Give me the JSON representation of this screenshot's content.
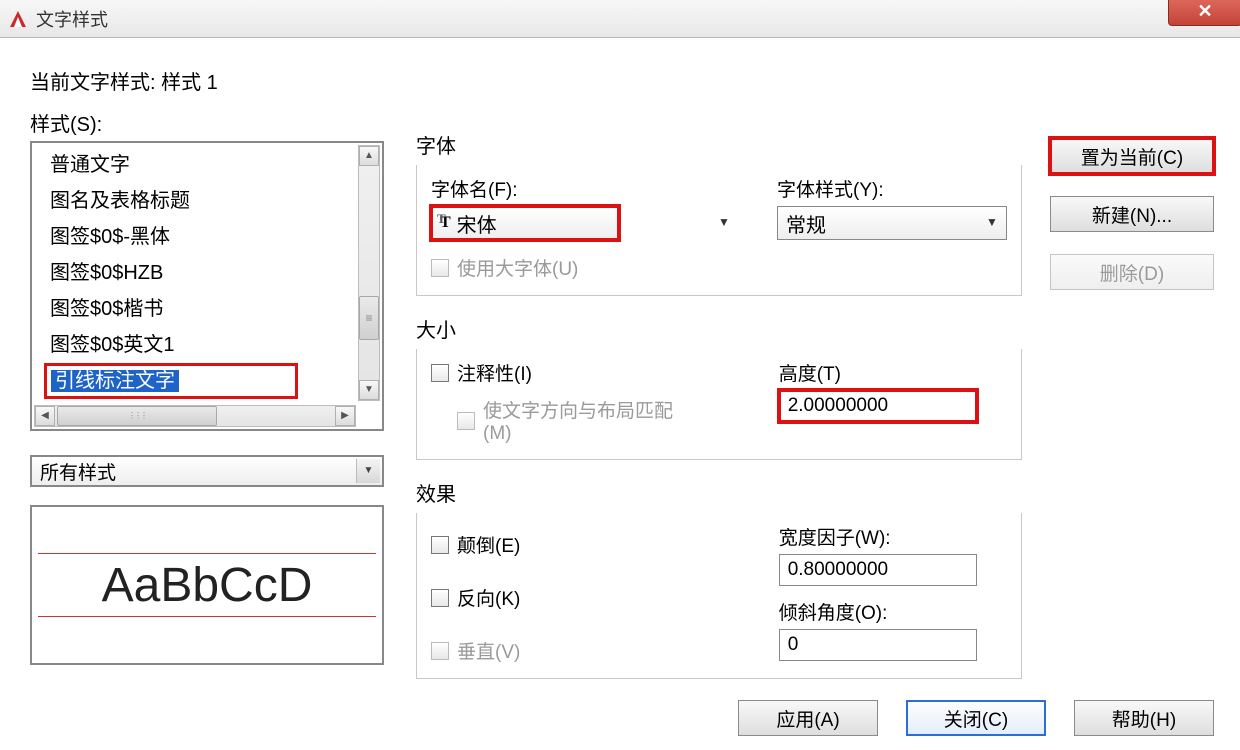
{
  "window": {
    "title": "文字样式"
  },
  "current_style_label": "当前文字样式:  样式 1",
  "styles_label": "样式(S):",
  "styles_list": {
    "items": [
      "普通文字",
      "图名及表格标题",
      "图签$0$-黑体",
      "图签$0$HZB",
      "图签$0$楷书",
      "图签$0$英文1"
    ],
    "selected": "引线标注文字"
  },
  "filter": {
    "value": "所有样式"
  },
  "preview": {
    "text": "AaBbCcD"
  },
  "font": {
    "group_label": "字体",
    "name_label": "字体名(F):",
    "name_value": "宋体",
    "style_label": "字体样式(Y):",
    "style_value": "常规",
    "bigfont_label": "使用大字体(U)"
  },
  "size": {
    "group_label": "大小",
    "annot_label": "注释性(I)",
    "match_label": "使文字方向与布局匹配(M)",
    "height_label": "高度(T)",
    "height_value": "2.00000000"
  },
  "effects": {
    "group_label": "效果",
    "upside_label": "颠倒(E)",
    "backwards_label": "反向(K)",
    "vertical_label": "垂直(V)",
    "widthf_label": "宽度因子(W):",
    "widthf_value": "0.80000000",
    "oblique_label": "倾斜角度(O):",
    "oblique_value": "0"
  },
  "buttons": {
    "set_current": "置为当前(C)",
    "new": "新建(N)...",
    "delete": "删除(D)",
    "apply": "应用(A)",
    "close": "关闭(C)",
    "help": "帮助(H)"
  }
}
